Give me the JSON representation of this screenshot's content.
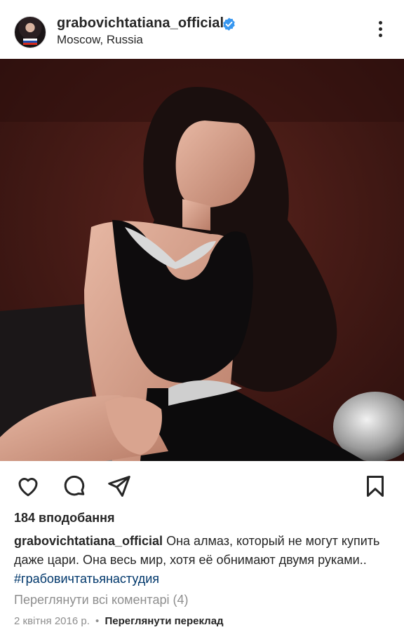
{
  "post": {
    "username": "grabovichtatiana_official",
    "location": "Moscow, Russia",
    "likes_text": "184 вподобання",
    "caption_username": "grabovichtatiana_official",
    "caption_text": "Она алмаз, который не могут купить даже цари. Она весь мир, хотя её обнимают двумя руками.. ",
    "hashtag": "#грабовичтатьянастудия",
    "view_comments": "Переглянути всі коментарі (4)",
    "date": "2 квітня 2016 р.",
    "separator": "•",
    "translate": "Переглянути переклад"
  },
  "icons": {
    "verified": "verified-badge-icon",
    "more": "more-options-icon",
    "like": "heart-icon",
    "comment": "comment-bubble-icon",
    "share": "paper-plane-icon",
    "save": "bookmark-icon"
  },
  "colors": {
    "text": "#262626",
    "secondary": "#8e8e8e",
    "hashtag": "#00376b",
    "verified": "#3897f0"
  }
}
